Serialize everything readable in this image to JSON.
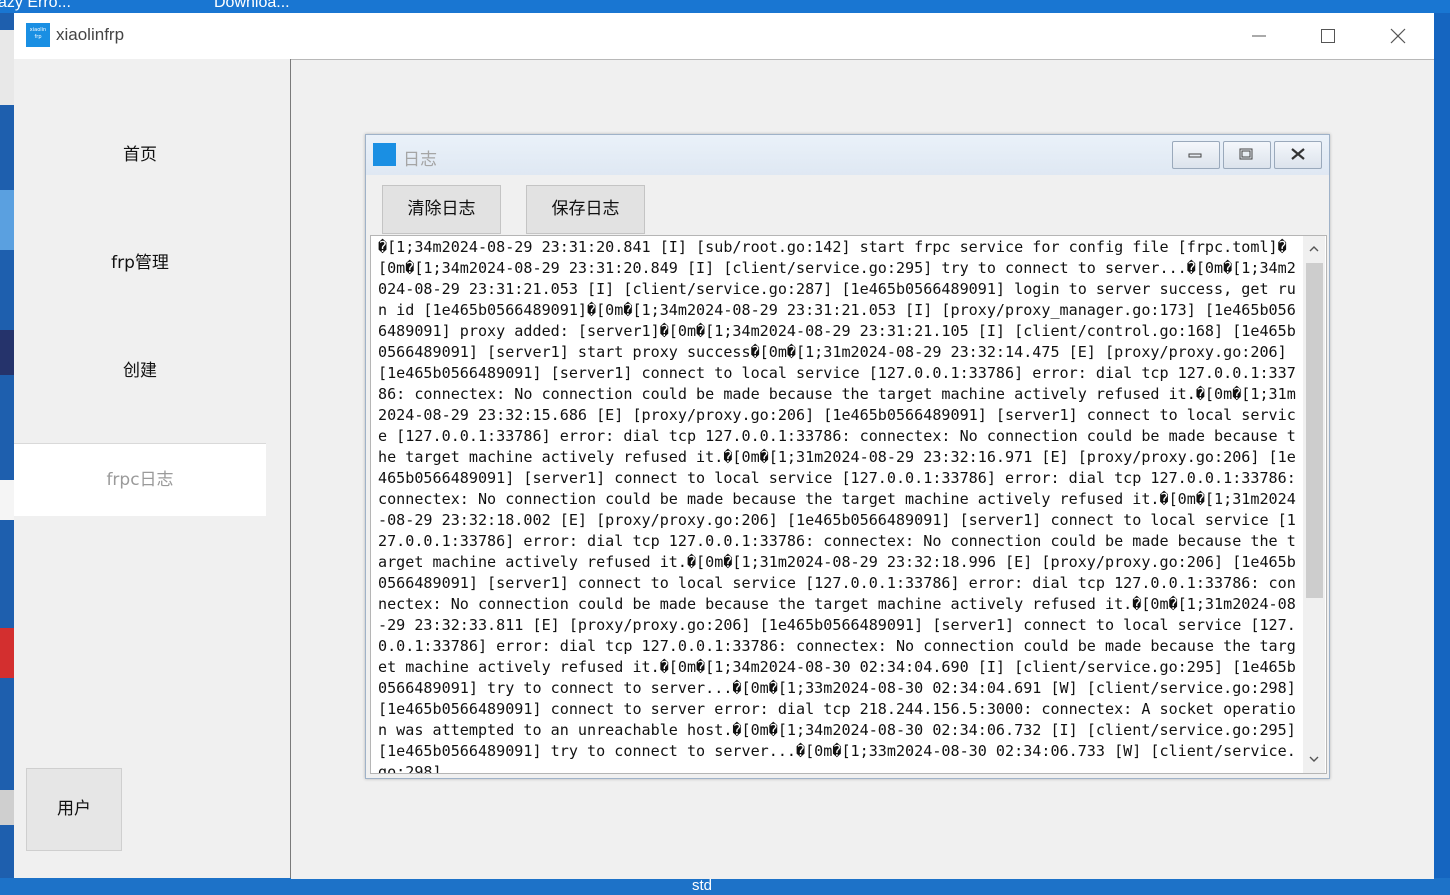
{
  "desktop": {
    "label_left": "azy Erro...",
    "label_right": "Downloa...",
    "taskbar_label": "std"
  },
  "window": {
    "logo_text": "xiaolin frp",
    "title": "xiaolinfrp"
  },
  "sidebar": {
    "items": [
      {
        "label": "首页"
      },
      {
        "label": "frp管理"
      },
      {
        "label": "创建"
      },
      {
        "label": "frpc日志"
      }
    ],
    "active_index": 3,
    "user_label": "用户"
  },
  "log_window": {
    "title": "日志",
    "clear_button": "清除日志",
    "save_button": "保存日志",
    "log_text": "�[1;34m2024-08-29 23:31:20.841 [I] [sub/root.go:142] start frpc service for config file [frpc.toml]�[0m�[1;34m2024-08-29 23:31:20.849 [I] [client/service.go:295] try to connect to server...�[0m�[1;34m2024-08-29 23:31:21.053 [I] [client/service.go:287] [1e465b0566489091] login to server success, get run id [1e465b0566489091]�[0m�[1;34m2024-08-29 23:31:21.053 [I] [proxy/proxy_manager.go:173] [1e465b0566489091] proxy added: [server1]�[0m�[1;34m2024-08-29 23:31:21.105 [I] [client/control.go:168] [1e465b0566489091] [server1] start proxy success�[0m�[1;31m2024-08-29 23:32:14.475 [E] [proxy/proxy.go:206] [1e465b0566489091] [server1] connect to local service [127.0.0.1:33786] error: dial tcp 127.0.0.1:33786: connectex: No connection could be made because the target machine actively refused it.�[0m�[1;31m2024-08-29 23:32:15.686 [E] [proxy/proxy.go:206] [1e465b0566489091] [server1] connect to local service [127.0.0.1:33786] error: dial tcp 127.0.0.1:33786: connectex: No connection could be made because the target machine actively refused it.�[0m�[1;31m2024-08-29 23:32:16.971 [E] [proxy/proxy.go:206] [1e465b0566489091] [server1] connect to local service [127.0.0.1:33786] error: dial tcp 127.0.0.1:33786: connectex: No connection could be made because the target machine actively refused it.�[0m�[1;31m2024-08-29 23:32:18.002 [E] [proxy/proxy.go:206] [1e465b0566489091] [server1] connect to local service [127.0.0.1:33786] error: dial tcp 127.0.0.1:33786: connectex: No connection could be made because the target machine actively refused it.�[0m�[1;31m2024-08-29 23:32:18.996 [E] [proxy/proxy.go:206] [1e465b0566489091] [server1] connect to local service [127.0.0.1:33786] error: dial tcp 127.0.0.1:33786: connectex: No connection could be made because the target machine actively refused it.�[0m�[1;31m2024-08-29 23:32:33.811 [E] [proxy/proxy.go:206] [1e465b0566489091] [server1] connect to local service [127.0.0.1:33786] error: dial tcp 127.0.0.1:33786: connectex: No connection could be made because the target machine actively refused it.�[0m�[1;34m2024-08-30 02:34:04.690 [I] [client/service.go:295] [1e465b0566489091] try to connect to server...�[0m�[1;33m2024-08-30 02:34:04.691 [W] [client/service.go:298] [1e465b0566489091] connect to server error: dial tcp 218.244.156.5:3000: connectex: A socket operation was attempted to an unreachable host.�[0m�[1;34m2024-08-30 02:34:06.732 [I] [client/service.go:295] [1e465b0566489091] try to connect to server...�[0m�[1;33m2024-08-30 02:34:06.733 [W] [client/service.go:298]"
  },
  "colors": {
    "accent": "#1a8fe3",
    "desktop": "#1565c0",
    "window_bg": "#f0f0f0"
  }
}
